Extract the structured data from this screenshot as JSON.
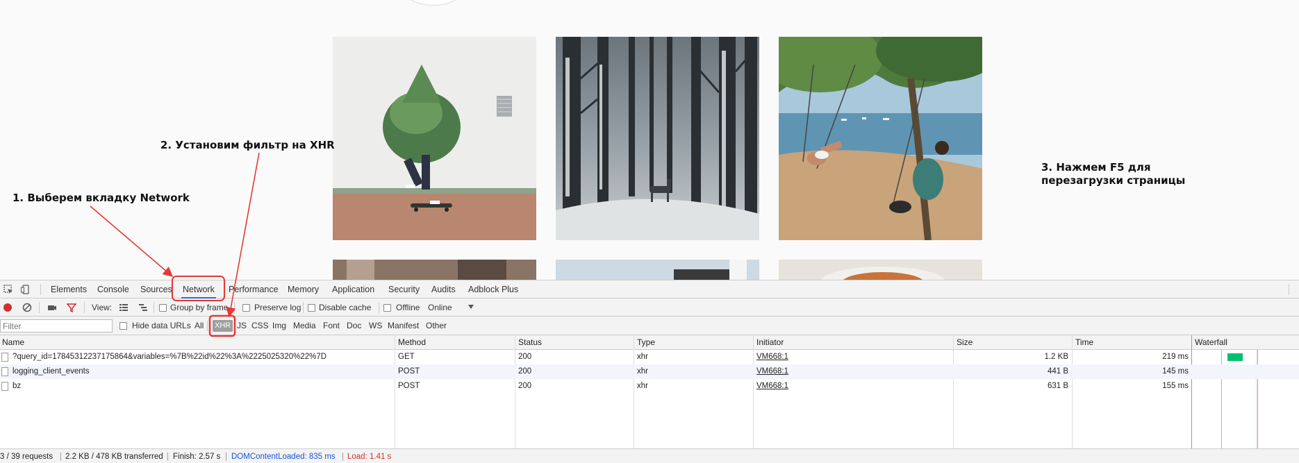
{
  "annotations": {
    "step1": "1. Выберем вкладку Network",
    "step2": "2. Установим фильтр на XHR",
    "step3": "3. Нажмем F5 для\nперезагрузки страницы"
  },
  "colors": {
    "highlight": "#e53935",
    "accent": "#1a73e8",
    "dom_content_loaded": "#1a56d6",
    "load": "#d32f2f",
    "record": "#d32f2f",
    "filter_icon": "#d32f2f",
    "waterfall_bar": "#00c070"
  },
  "devtools": {
    "tabs": [
      "Elements",
      "Console",
      "Sources",
      "Network",
      "Performance",
      "Memory",
      "Application",
      "Security",
      "Audits",
      "Adblock Plus"
    ],
    "active_tab": "Network",
    "toolbar": {
      "view_label": "View:",
      "group_by_frame": "Group by frame",
      "preserve_log": "Preserve log",
      "disable_cache": "Disable cache",
      "offline": "Offline",
      "throttle": "Online",
      "dropdown_icon": "triangle-down-icon"
    },
    "filter": {
      "placeholder": "Filter",
      "hide_data_urls": "Hide data URLs",
      "types": [
        "All",
        "XHR",
        "JS",
        "CSS",
        "Img",
        "Media",
        "Font",
        "Doc",
        "WS",
        "Manifest",
        "Other"
      ],
      "active_type": "XHR"
    },
    "columns": [
      "Name",
      "Method",
      "Status",
      "Type",
      "Initiator",
      "Size",
      "Time",
      "Waterfall"
    ],
    "rows": [
      {
        "name": "?query_id=17845312237175864&variables=%7B%22id%22%3A%2225025320%22%7D",
        "method": "GET",
        "status": "200",
        "type": "xhr",
        "initiator": "VM668:1",
        "size": "1.2 KB",
        "time": "219 ms"
      },
      {
        "name": "logging_client_events",
        "method": "POST",
        "status": "200",
        "type": "xhr",
        "initiator": "VM668:1",
        "size": "441 B",
        "time": "145 ms"
      },
      {
        "name": "bz",
        "method": "POST",
        "status": "200",
        "type": "xhr",
        "initiator": "VM668:1",
        "size": "631 B",
        "time": "155 ms"
      }
    ],
    "status": {
      "requests": "3 / 39 requests",
      "transferred": "2.2 KB / 478 KB transferred",
      "finish": "Finish: 2.57 s",
      "dom_content_loaded": "DOMContentLoaded: 835 ms",
      "load": "Load: 1.41 s"
    }
  }
}
